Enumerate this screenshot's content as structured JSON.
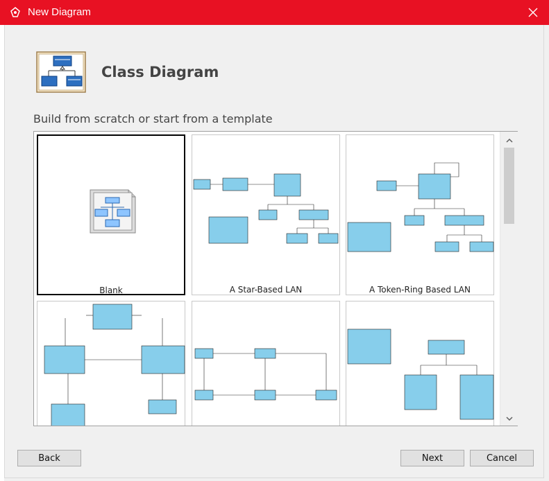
{
  "window": {
    "title": "New Diagram"
  },
  "header": {
    "title": "Class Diagram"
  },
  "gallery": {
    "subtitle": "Build from scratch or start from a template",
    "templates": [
      {
        "label": "Blank"
      },
      {
        "label": "A Star-Based LAN"
      },
      {
        "label": "A Token-Ring Based LAN"
      },
      {
        "label": ""
      },
      {
        "label": ""
      },
      {
        "label": ""
      }
    ]
  },
  "buttons": {
    "back": "Back",
    "next": "Next",
    "cancel": "Cancel"
  },
  "colors": {
    "titlebar": "#e81123",
    "uml_class_fill": "#87ceeb"
  }
}
